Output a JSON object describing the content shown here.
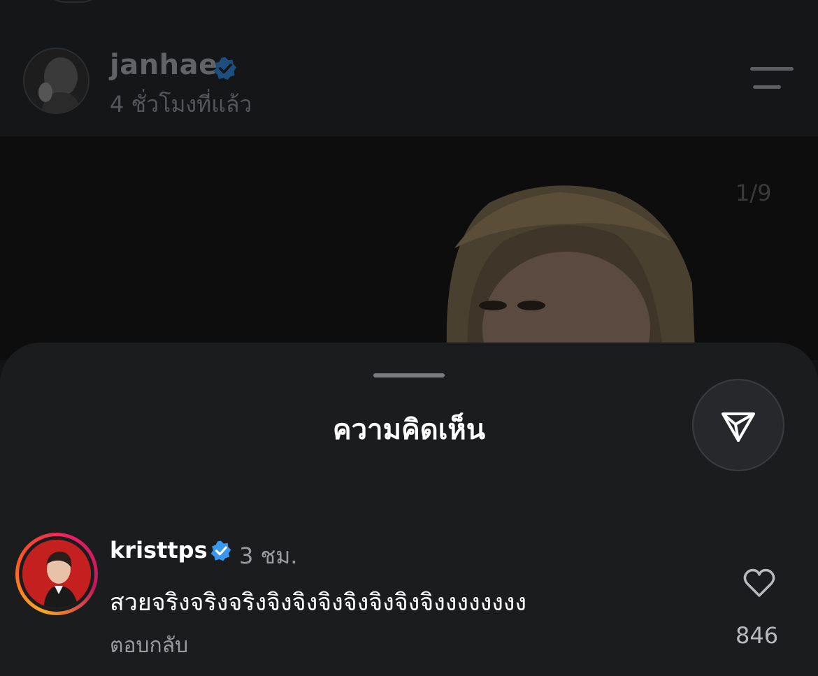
{
  "post": {
    "author": "janhae",
    "time": "4 ชั่วโมงที่แล้ว",
    "page_indicator": "1/9"
  },
  "comments_sheet": {
    "title": "ความคิดเห็น",
    "comments": [
      {
        "user": "kristtps",
        "time": "3 ชม.",
        "text": "สวยจริงจริงจริงจิงจิงจิงจิงจิงจิงจิงงงงงงงง",
        "reply_label": "ตอบกลับ",
        "likes": "846"
      }
    ]
  },
  "colors": {
    "verified_badge": "#3897f0",
    "sheet_background": "#1b1c1e",
    "secondary_text": "#9a9ca0"
  },
  "icons": [
    "verified-badge-icon",
    "menu-icon",
    "send-icon",
    "heart-icon"
  ]
}
